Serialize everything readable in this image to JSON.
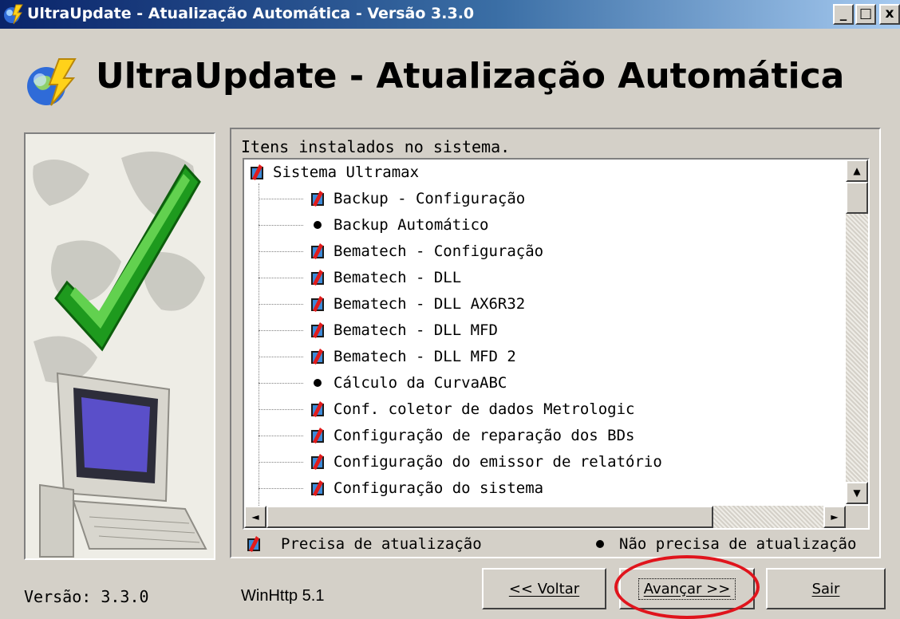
{
  "window": {
    "title": "UltraUpdate - Atualização Automática - Versão 3.3.0",
    "controls": {
      "minimize": "_",
      "maximize": "□",
      "close": "x"
    }
  },
  "header": {
    "title": "UltraUpdate - Atualização Automática"
  },
  "group": {
    "title": "Itens instalados no sistema."
  },
  "tree": {
    "root": {
      "label": "Sistema Ultramax",
      "status": "needs_update"
    },
    "items": [
      {
        "label": "Backup - Configuração",
        "status": "needs_update"
      },
      {
        "label": "Backup Automático",
        "status": "up_to_date"
      },
      {
        "label": "Bematech - Configuração",
        "status": "needs_update"
      },
      {
        "label": "Bematech - DLL",
        "status": "needs_update"
      },
      {
        "label": "Bematech - DLL AX6R32",
        "status": "needs_update"
      },
      {
        "label": "Bematech - DLL MFD",
        "status": "needs_update"
      },
      {
        "label": "Bematech - DLL MFD 2",
        "status": "needs_update"
      },
      {
        "label": "Cálculo da CurvaABC",
        "status": "up_to_date"
      },
      {
        "label": "Conf. coletor de dados Metrologic",
        "status": "needs_update"
      },
      {
        "label": "Configuração de reparação dos BDs",
        "status": "needs_update"
      },
      {
        "label": "Configuração do emissor de relatório",
        "status": "needs_update"
      },
      {
        "label": "Configuração do sistema",
        "status": "needs_update"
      }
    ]
  },
  "legend": {
    "needs_update": "Precisa de atualização",
    "up_to_date": "Não precisa de atualização"
  },
  "buttons": {
    "back": "<< Voltar",
    "next": "Avançar >>",
    "exit": "Sair"
  },
  "footer": {
    "version": "Versão: 3.3.0",
    "winhttp": "WinHttp 5.1"
  },
  "colors": {
    "title_bar": "#0a246a",
    "highlight_circle": "#e0141c",
    "needs_update_icon": "#e21b1b"
  }
}
